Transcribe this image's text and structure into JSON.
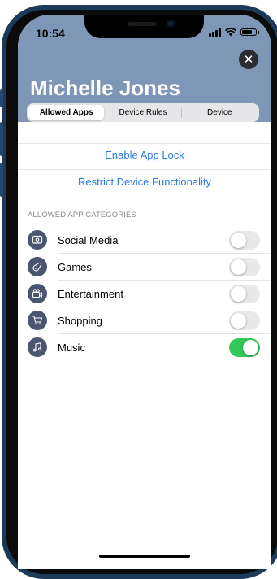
{
  "status_bar": {
    "time": "10:54"
  },
  "header": {
    "title": "Michelle Jones",
    "close_icon": "close-icon",
    "tabs": [
      {
        "label": "Allowed Apps",
        "selected": true
      },
      {
        "label": "Device Rules",
        "selected": false
      },
      {
        "label": "Device",
        "selected": false
      }
    ]
  },
  "actions": {
    "enable_app_lock": "Enable App Lock",
    "restrict_device": "Restrict Device Functionality"
  },
  "categories_section": {
    "header": "ALLOWED APP CATEGORIES",
    "items": [
      {
        "label": "Social Media",
        "icon": "social-media-icon",
        "enabled": false
      },
      {
        "label": "Games",
        "icon": "games-icon",
        "enabled": false
      },
      {
        "label": "Entertainment",
        "icon": "entertainment-icon",
        "enabled": false
      },
      {
        "label": "Shopping",
        "icon": "shopping-icon",
        "enabled": false
      },
      {
        "label": "Music",
        "icon": "music-icon",
        "enabled": true
      }
    ]
  },
  "colors": {
    "header_bg": "#7f97b6",
    "accent_link": "#2a7be0",
    "toggle_on": "#34c759",
    "icon_bg": "#4a5570"
  }
}
